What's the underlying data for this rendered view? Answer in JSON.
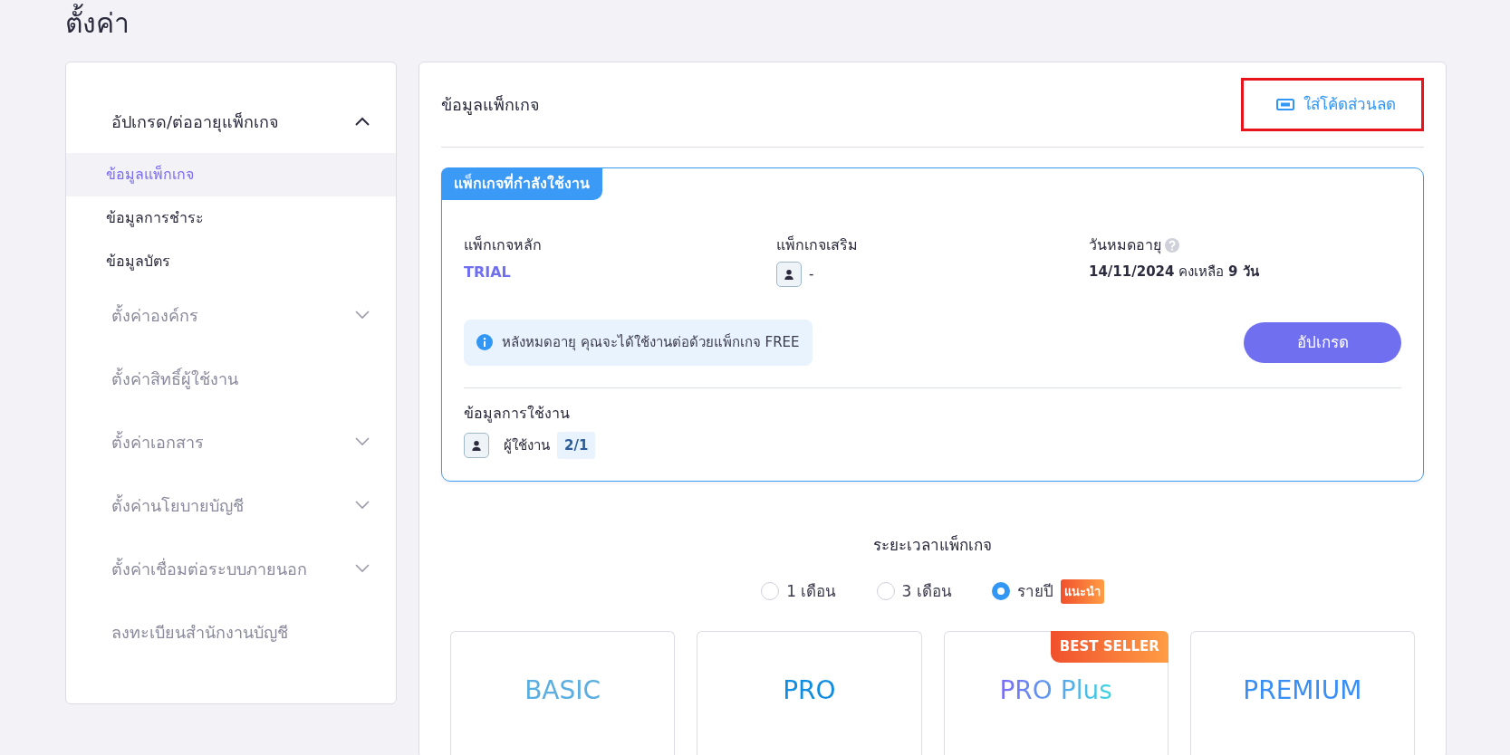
{
  "page_title": "ตั้งค่า",
  "sidebar": {
    "groups": [
      {
        "label": "อัปเกรด/ต่ออายุแพ็กเกจ",
        "has_children": true,
        "expanded": true,
        "children": [
          {
            "label": "ข้อมูลแพ็กเกจ",
            "selected": true
          },
          {
            "label": "ข้อมูลการชำระ",
            "selected": false
          },
          {
            "label": "ข้อมูลบัตร",
            "selected": false
          }
        ]
      },
      {
        "label": "ตั้งค่าองค์กร",
        "has_children": true,
        "expanded": false
      },
      {
        "label": "ตั้งค่าสิทธิ์ผู้ใช้งาน",
        "has_children": false,
        "expanded": false
      },
      {
        "label": "ตั้งค่าเอกสาร",
        "has_children": true,
        "expanded": false
      },
      {
        "label": "ตั้งค่านโยบายบัญชี",
        "has_children": true,
        "expanded": false
      },
      {
        "label": "ตั้งค่าเชื่อมต่อระบบภายนอก",
        "has_children": true,
        "expanded": false
      },
      {
        "label": "ลงทะเบียนสำนักงานบัญชี",
        "has_children": false,
        "expanded": false
      }
    ]
  },
  "main": {
    "title": "ข้อมูลแพ็กเกจ",
    "coupon_button": {
      "label": "ใส่โค้ดส่วนลด",
      "highlighted": true
    },
    "current_package": {
      "tag": "แพ็กเกจที่กำลังใช้งาน",
      "main_label": "แพ็กเกจหลัก",
      "main_value": "TRIAL",
      "addon_label": "แพ็กเกจเสริม",
      "addon_value": "-",
      "expiry_label": "วันหมดอายุ",
      "expiry_value": "**14/11/2024** คงเหลือ **9 วัน**",
      "notice": "หลังหมดอายุ คุณจะได้ใช้งานต่อด้วยแพ็กเกจ FREE",
      "upgrade_button": "อัปเกรด",
      "usage_title": "ข้อมูลการใช้งาน",
      "usage_label": "ผู้ใช้งาน",
      "usage_value": "2/1"
    },
    "duration": {
      "title": "ระยะเวลาแพ็กเกจ",
      "options": [
        {
          "label": "1 เดือน",
          "selected": false
        },
        {
          "label": "3 เดือน",
          "selected": false
        },
        {
          "label": "รายปี",
          "selected": true,
          "badge": "แนะนำ"
        }
      ]
    },
    "plans": [
      {
        "name": "BASIC",
        "kind": "basic"
      },
      {
        "name": "PRO",
        "kind": "pro"
      },
      {
        "name": "PRO Plus",
        "kind": "proplus",
        "ribbon": "BEST SELLER"
      },
      {
        "name": "PREMIUM",
        "kind": "premium"
      }
    ]
  }
}
